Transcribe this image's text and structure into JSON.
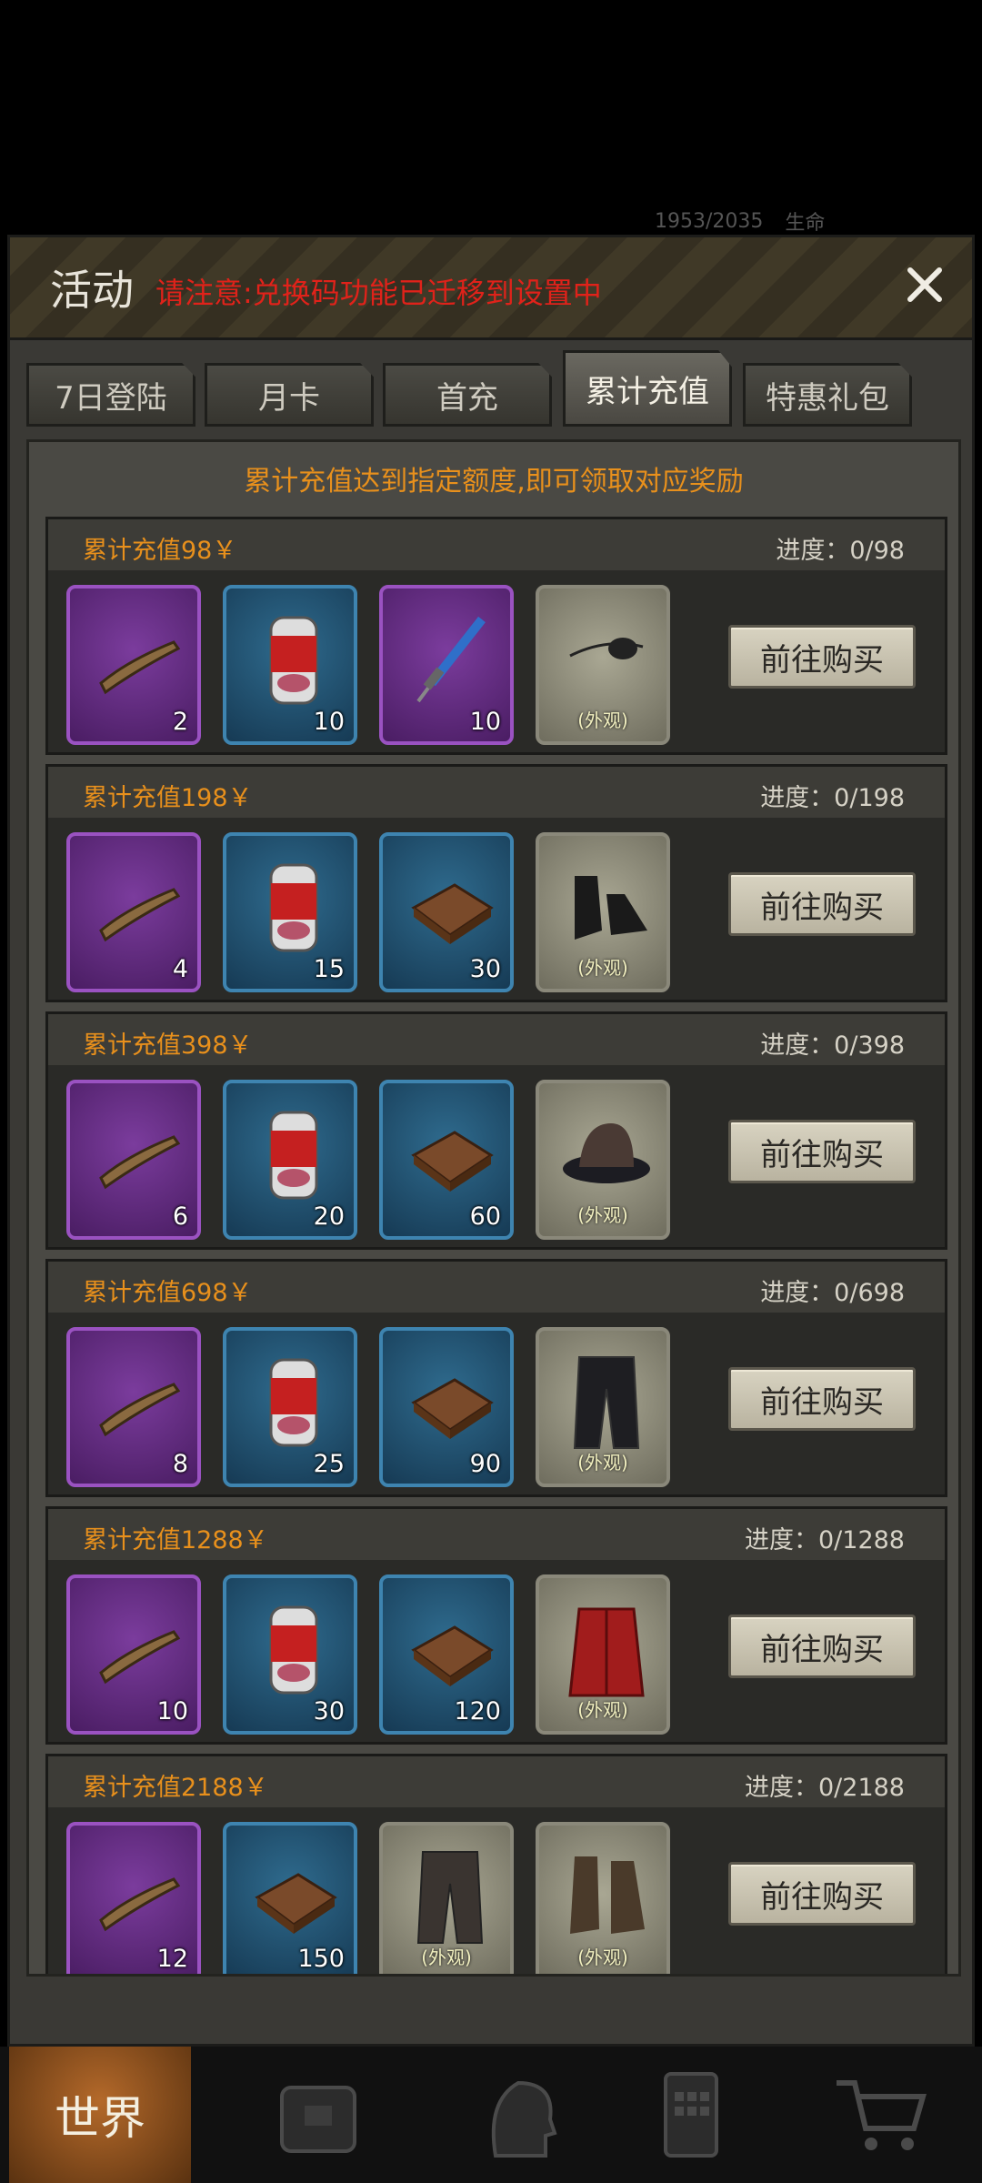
{
  "status_hint": {
    "hp": "1953/2035",
    "label": "生命"
  },
  "modal": {
    "title": "活动",
    "notice": "请注意:兑换码功能已迁移到设置中"
  },
  "tabs": [
    {
      "label": "7日登陆"
    },
    {
      "label": "月卡"
    },
    {
      "label": "首充"
    },
    {
      "label": "累计充值"
    },
    {
      "label": "特惠礼包"
    }
  ],
  "hint": "累计充值达到指定额度,即可领取对应奖励",
  "buy_label": "前往购买",
  "appearance_label": "(外观)",
  "tiers": [
    {
      "title": "累计充值98￥",
      "progress": "进度：0/98",
      "items": [
        {
          "icon": "stick-icon",
          "count": "2"
        },
        {
          "icon": "meat-can-icon",
          "count": "10"
        },
        {
          "icon": "syringe-icon",
          "count": "10"
        },
        {
          "icon": "eyepatch-icon",
          "count": ""
        }
      ]
    },
    {
      "title": "累计充值198￥",
      "progress": "进度：0/198",
      "items": [
        {
          "icon": "stick-icon",
          "count": "4"
        },
        {
          "icon": "meat-can-icon",
          "count": "15"
        },
        {
          "icon": "material-box-icon",
          "count": "30"
        },
        {
          "icon": "shoes-icon",
          "count": ""
        }
      ]
    },
    {
      "title": "累计充值398￥",
      "progress": "进度：0/398",
      "items": [
        {
          "icon": "stick-icon",
          "count": "6"
        },
        {
          "icon": "meat-can-icon",
          "count": "20"
        },
        {
          "icon": "material-box-icon",
          "count": "60"
        },
        {
          "icon": "hat-icon",
          "count": ""
        }
      ]
    },
    {
      "title": "累计充值698￥",
      "progress": "进度：0/698",
      "items": [
        {
          "icon": "stick-icon",
          "count": "8"
        },
        {
          "icon": "meat-can-icon",
          "count": "25"
        },
        {
          "icon": "material-box-icon",
          "count": "90"
        },
        {
          "icon": "trousers-icon",
          "count": ""
        }
      ]
    },
    {
      "title": "累计充值1288￥",
      "progress": "进度：0/1288",
      "items": [
        {
          "icon": "stick-icon",
          "count": "10"
        },
        {
          "icon": "meat-can-icon",
          "count": "30"
        },
        {
          "icon": "material-box-icon",
          "count": "120"
        },
        {
          "icon": "coat-icon",
          "count": ""
        }
      ]
    },
    {
      "title": "累计充值2188￥",
      "progress": "进度：0/2188",
      "items": [
        {
          "icon": "stick-icon",
          "count": "12"
        },
        {
          "icon": "material-box-icon",
          "count": "150"
        },
        {
          "icon": "striped-trousers-icon",
          "count": ""
        },
        {
          "icon": "boots-icon",
          "count": ""
        }
      ]
    }
  ],
  "bottom_nav": {
    "world_label": "世界"
  }
}
